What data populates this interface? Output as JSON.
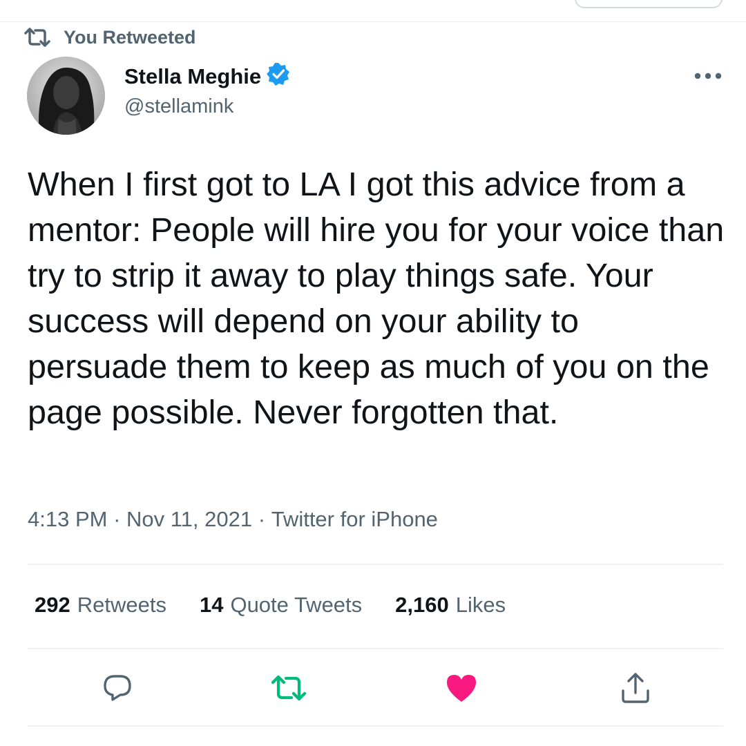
{
  "context": {
    "retweet_label": "You Retweeted",
    "retweet_icon": "retweet-icon"
  },
  "author": {
    "name": "Stella Meghie",
    "handle": "@stellamink",
    "verified_icon": "verified-badge-icon",
    "avatar_icon": "avatar"
  },
  "tweet": {
    "text": "When I first got to LA I got this advice from a mentor: People will hire you for your voice than try to strip it away to play things safe. Your success will depend on your ability to persuade them to keep as much of you on the page possible. Never forgotten that.",
    "time": "4:13 PM",
    "separator": " · ",
    "date": "Nov 11, 2021",
    "source": "Twitter for iPhone"
  },
  "stats": {
    "retweets_count": "292",
    "retweets_label": "Retweets",
    "quotes_count": "14",
    "quotes_label": "Quote Tweets",
    "likes_count": "2,160",
    "likes_label": "Likes"
  },
  "actions": {
    "reply_icon": "reply-icon",
    "retweet_icon": "retweet-icon",
    "like_icon": "heart-icon",
    "share_icon": "share-icon"
  },
  "colors": {
    "text_primary": "#0f1419",
    "text_secondary": "#536471",
    "verified_blue": "#1d9bf0",
    "retweet_green": "#00ba7c",
    "like_pink": "#f91880",
    "divider": "#eef1f3"
  }
}
